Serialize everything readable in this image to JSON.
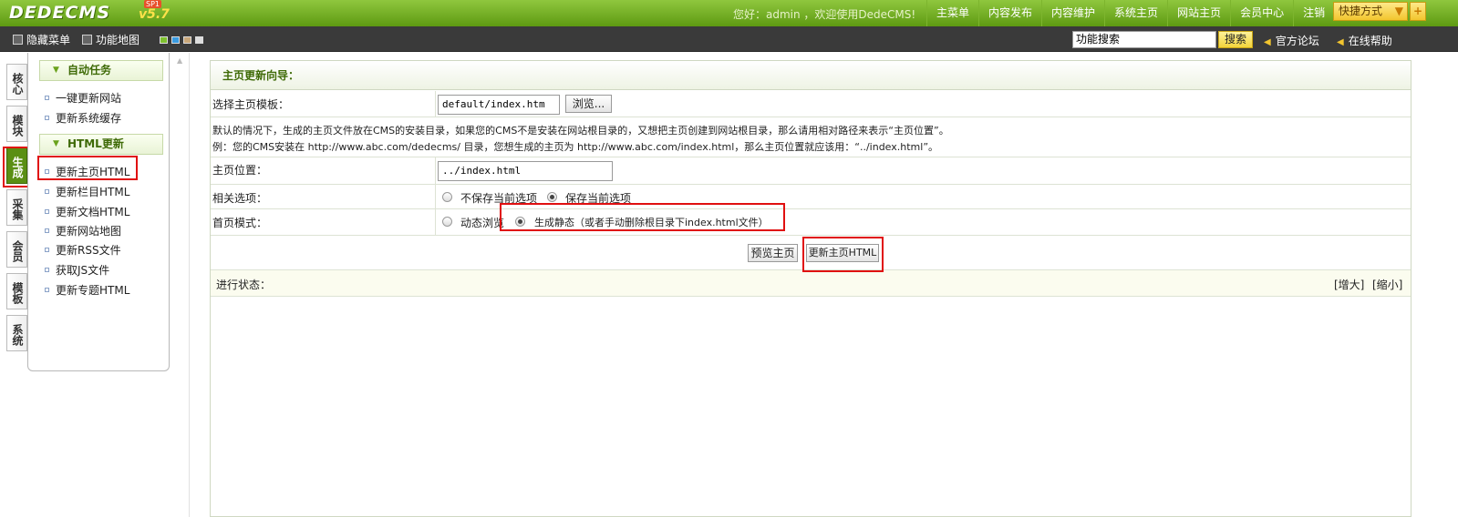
{
  "header": {
    "logo_text": "DEDECMS",
    "version": "v5.7",
    "badge": "SP1",
    "welcome": "您好：admin ，欢迎使用DedeCMS!",
    "nav": [
      "主菜单",
      "内容发布",
      "内容维护",
      "系统主页",
      "网站主页",
      "会员中心",
      "注销"
    ],
    "quick_label": "快捷方式",
    "quick_plus": "+"
  },
  "toolbar": {
    "hide_menu": "隐藏菜单",
    "site_map": "功能地图",
    "swatch_colors": [
      "#7ec12e",
      "#3a9be0",
      "#c9a77a",
      "#dddddd"
    ],
    "search_value": "功能搜索",
    "search_button": "搜索",
    "forum": "官方论坛",
    "help": "在线帮助"
  },
  "vtabs": [
    {
      "label": "核心",
      "active": false
    },
    {
      "label": "模块",
      "active": false
    },
    {
      "label": "生成",
      "active": true
    },
    {
      "label": "采集",
      "active": false
    },
    {
      "label": "会员",
      "active": false
    },
    {
      "label": "模板",
      "active": false
    },
    {
      "label": "系统",
      "active": false
    }
  ],
  "sidebar": {
    "group1_title": "自动任务",
    "group1_items": [
      "一键更新网站",
      "更新系统缓存"
    ],
    "group2_title": "HTML更新",
    "group2_items": [
      "更新主页HTML",
      "更新栏目HTML",
      "更新文档HTML",
      "更新网站地图",
      "更新RSS文件",
      "获取JS文件",
      "更新专题HTML"
    ]
  },
  "main": {
    "title": "主页更新向导：",
    "template_label": "选择主页模板：",
    "template_value": "default/index.htm",
    "browse_button": "浏览...",
    "note_line1": "默认的情况下，生成的主页文件放在CMS的安装目录，如果您的CMS不是安装在网站根目录的，又想把主页创建到网站根目录，那么请用相对路径来表示“主页位置”。",
    "note_line2": "例：您的CMS安装在 http://www.abc.com/dedecms/ 目录，您想生成的主页为 http://www.abc.com/index.html，那么主页位置就应该用：“../index.html”。",
    "position_label": "主页位置：",
    "position_value": "../index.html",
    "options_label": "相关选项：",
    "option_nosave": "不保存当前选项",
    "option_save": "保存当前选项",
    "mode_label": "首页模式：",
    "mode_dynamic": "动态浏览",
    "mode_static": "生成静态（或者手动删除根目录下index.html文件）",
    "preview_button": "预览主页",
    "update_button": "更新主页HTML",
    "status_label": "进行状态：",
    "enlarge": "[增大]",
    "shrink": "[缩小]"
  }
}
